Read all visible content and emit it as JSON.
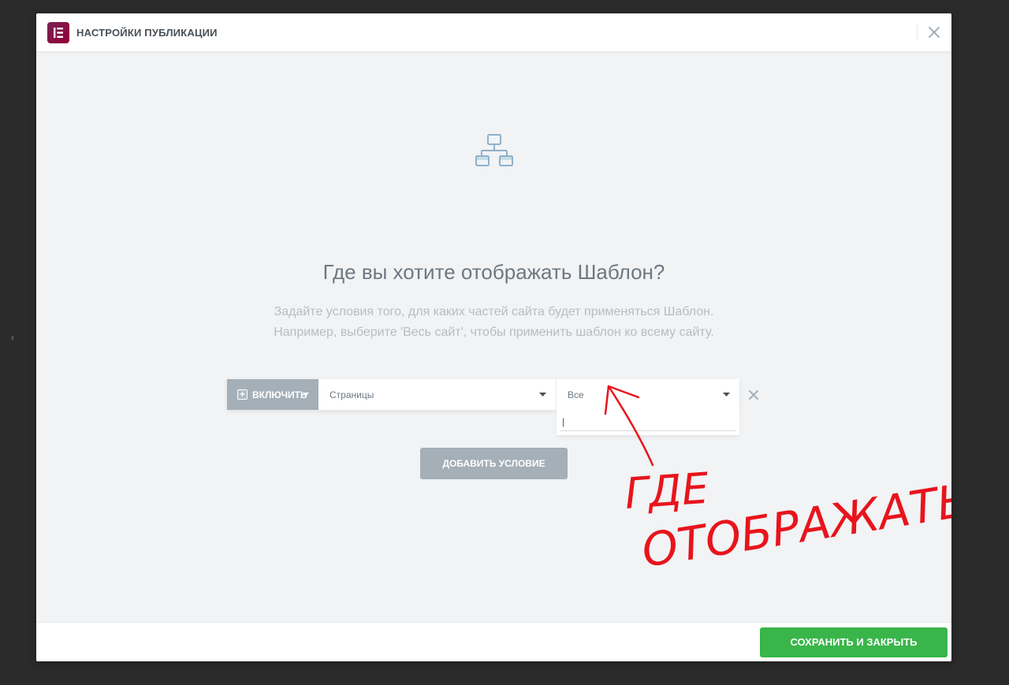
{
  "modal": {
    "title": "НАСТРОЙКИ ПУБЛИКАЦИИ"
  },
  "icons": {
    "logo": "elementor-logo-icon",
    "close": "close-icon",
    "hero": "sitemap-icon",
    "include": "plus-square-icon",
    "caret": "caret-down-icon",
    "remove": "close-icon"
  },
  "content": {
    "heading": "Где вы хотите отображать Шаблон?",
    "description_line1": "Задайте условия того, для каких частей сайта будет применяться Шаблон.",
    "description_line2": "Например, выберите 'Весь сайт', чтобы применить шаблон ко всему сайту."
  },
  "condition": {
    "include_label": "ВКЛЮЧИТЬ",
    "type_value": "Страницы",
    "sub_value": "Все",
    "search_value": "|"
  },
  "add_condition_label": "ДОБАВИТЬ УСЛОВИЕ",
  "annotation": {
    "line1": "ГДЕ",
    "line2": "ОТОБРАЖАТЬ",
    "color": "#e8141c"
  },
  "footer": {
    "save_label": "СОХРАНИТЬ И ЗАКРЫТЬ"
  },
  "colors": {
    "accent_green": "#39b54a",
    "neutral_button": "#a4afb7",
    "brand": "#93003a"
  }
}
